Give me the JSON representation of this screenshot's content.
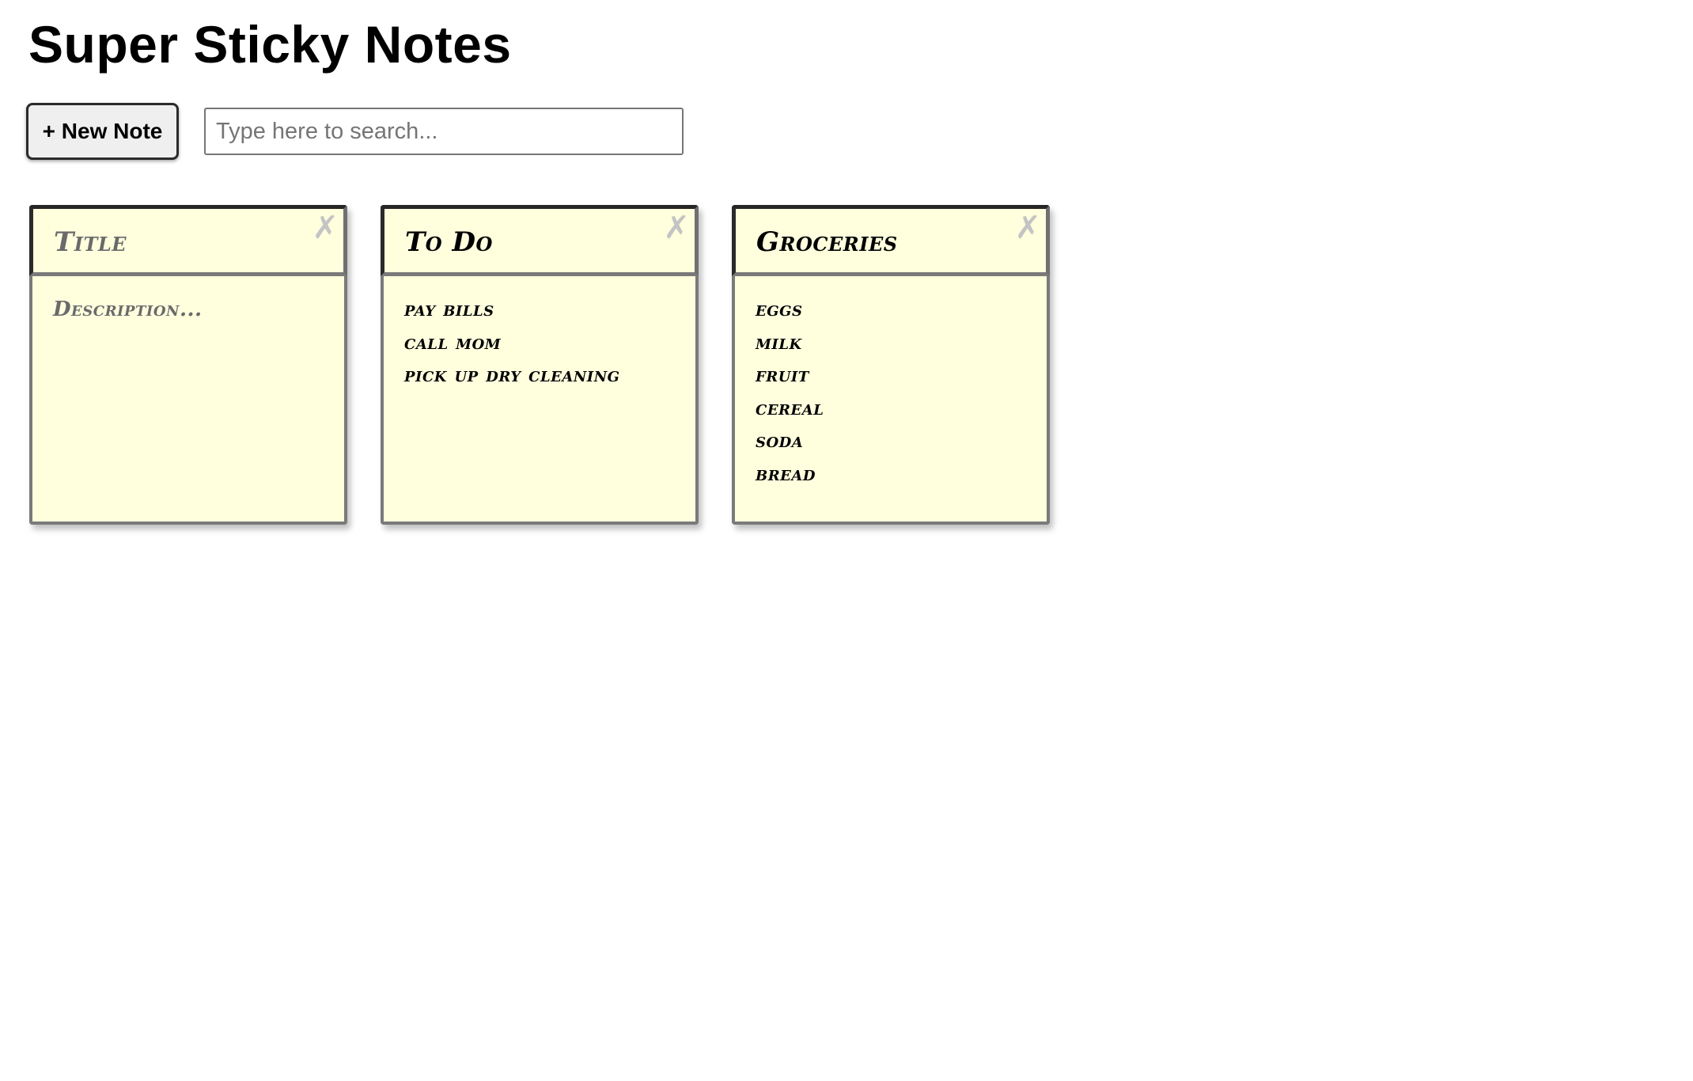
{
  "app": {
    "title": "Super Sticky Notes"
  },
  "toolbar": {
    "new_note_label": "+ New Note",
    "search_placeholder": "Type here to search...",
    "search_value": ""
  },
  "notes": [
    {
      "title": "",
      "title_placeholder": "Title",
      "description_placeholder": "Description...",
      "lines": []
    },
    {
      "title": "To Do",
      "lines": [
        "pay bills",
        "call mom",
        "pick up dry cleaning"
      ]
    },
    {
      "title": "Groceries",
      "lines": [
        "eggs",
        "milk",
        "fruit",
        "cereal",
        "soda",
        "bread"
      ]
    }
  ],
  "icons": {
    "close": "close-icon"
  },
  "colors": {
    "note_background": "#ffffde",
    "note_border": "#7a7a7a",
    "placeholder_text": "#6a6a6a",
    "close_icon": "#c4c4c4"
  }
}
